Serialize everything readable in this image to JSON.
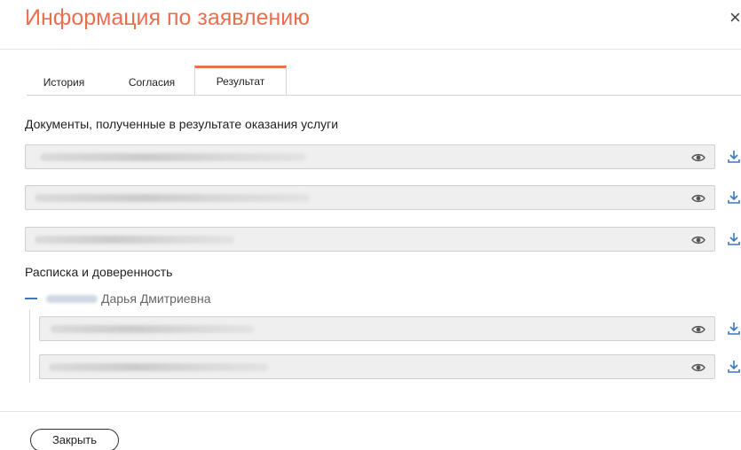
{
  "dialog": {
    "title": "Информация по заявлению",
    "close_glyph": "×"
  },
  "tabs": [
    {
      "label": "История",
      "active": false
    },
    {
      "label": "Согласия",
      "active": false
    },
    {
      "label": "Результат",
      "active": true
    }
  ],
  "result": {
    "documents_title": "Документы, полученные в результате оказания услуги",
    "documents": [
      {
        "name": "",
        "blurred": true
      },
      {
        "name": "",
        "blurred": true
      },
      {
        "name": "",
        "blurred": true
      }
    ],
    "receipt_title": "Расписка и доверенность",
    "person": {
      "collapse_glyph": "—",
      "name_suffix": "Дарья Дмитриевна"
    },
    "person_documents": [
      {
        "name": "",
        "blurred": true
      },
      {
        "name": "",
        "blurred": true
      }
    ]
  },
  "footer": {
    "close_label": "Закрыть"
  },
  "colors": {
    "accent": "#ea6f4f",
    "tree_dash": "#3a78c2",
    "field_bg": "#efefef"
  },
  "icons": {
    "view": "eye-icon",
    "download": "download-icon",
    "close": "close-icon"
  }
}
